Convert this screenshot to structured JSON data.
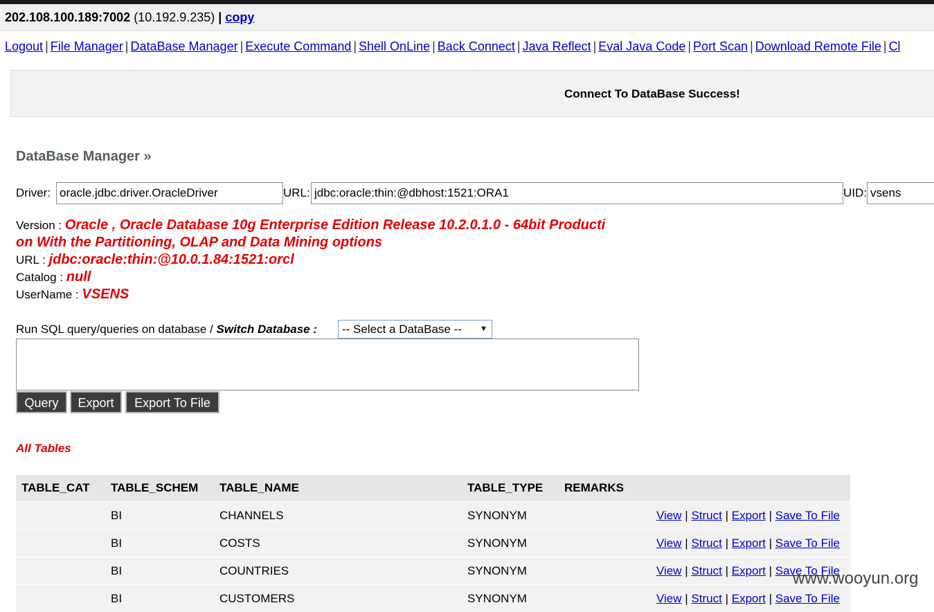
{
  "header": {
    "host": "202.108.100.189:7002",
    "ip": "(10.192.9.235)",
    "sep": "|",
    "copy": "copy"
  },
  "nav": [
    "Logout",
    "File Manager",
    "DataBase Manager",
    "Execute Command",
    "Shell OnLine",
    "Back Connect",
    "Java Reflect",
    "Eval Java Code",
    "Port Scan",
    "Download Remote File",
    "Cl"
  ],
  "banner": {
    "message": "Connect To DataBase Success!"
  },
  "section_title": "DataBase Manager »",
  "form": {
    "driver_label": "Driver:",
    "driver_value": "oracle.jdbc.driver.OracleDriver",
    "url_label": "URL:",
    "url_value": "jdbc:oracle:thin:@dbhost:1521:ORA1",
    "uid_label": "UID:",
    "uid_value": "vsens"
  },
  "info": {
    "version_label": "Version :",
    "version_line1": "Oracle , Oracle Database 10g Enterprise Edition Release 10.2.0.1.0 - 64bit Producti",
    "version_line2": "on With the Partitioning, OLAP and Data Mining options",
    "url_label": "URL :",
    "url_value": "jdbc:oracle:thin:@10.0.1.84:1521:orcl",
    "catalog_label": "Catalog :",
    "catalog_value": "null",
    "username_label": "UserName :",
    "username_value": "VSENS"
  },
  "sql": {
    "label": "Run SQL query/queries on database /",
    "switch_label": "Switch Database :",
    "select_value": "-- Select a DataBase --",
    "query": "",
    "buttons": {
      "query": "Query",
      "export": "Export",
      "export_to_file": "Export To File"
    }
  },
  "all_tables": "All Tables",
  "table": {
    "columns": [
      "TABLE_CAT",
      "TABLE_SCHEM",
      "TABLE_NAME",
      "TABLE_TYPE",
      "REMARKS"
    ],
    "actions": {
      "view": "View",
      "struct": "Struct",
      "export": "Export",
      "save": "Save To File",
      "sep": "|"
    },
    "rows": [
      {
        "cat": "",
        "schem": "BI",
        "name": "CHANNELS",
        "type": "SYNONYM",
        "remarks": ""
      },
      {
        "cat": "",
        "schem": "BI",
        "name": "COSTS",
        "type": "SYNONYM",
        "remarks": ""
      },
      {
        "cat": "",
        "schem": "BI",
        "name": "COUNTRIES",
        "type": "SYNONYM",
        "remarks": ""
      },
      {
        "cat": "",
        "schem": "BI",
        "name": "CUSTOMERS",
        "type": "SYNONYM",
        "remarks": ""
      }
    ]
  },
  "watermark": "www.wooyun.org"
}
